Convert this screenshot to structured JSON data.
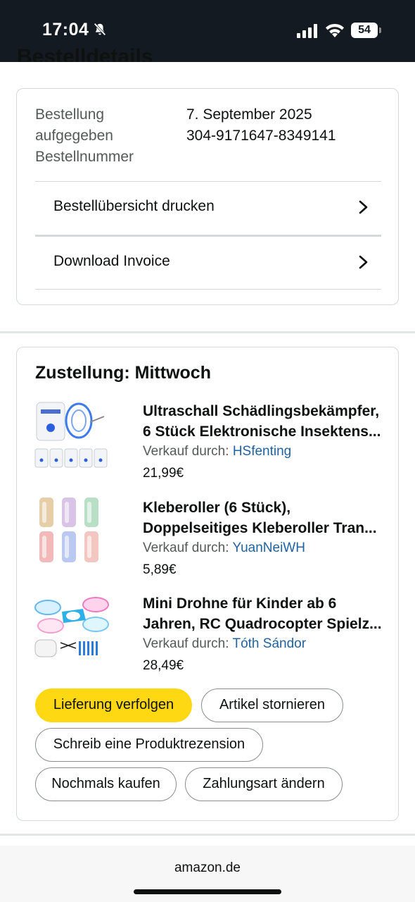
{
  "status_bar": {
    "time": "17:04",
    "battery": "54",
    "icons": [
      "bell-slash-icon",
      "cellular-signal-icon",
      "wifi-icon",
      "battery-icon"
    ]
  },
  "page": {
    "heading_partial": "Bestelldetails"
  },
  "order_info": {
    "labels": [
      "Bestellung",
      "aufgegeben",
      "Bestellnummer"
    ],
    "date": "7. September 2025",
    "order_number": "304-9171647-8349141",
    "links": [
      {
        "label": "Bestellübersicht drucken"
      },
      {
        "label": "Download Invoice"
      }
    ]
  },
  "delivery": {
    "title": "Zustellung: Mittwoch",
    "seller_prefix": "Verkauf durch:",
    "items": [
      {
        "title_line1": "Ultraschall Schädlingsbekämpfer,",
        "title_line2": "6 Stück Elektronische Insektens...",
        "seller": "HSfenting",
        "price": "21,99€",
        "image": "ultrasonic-pest-repeller-image"
      },
      {
        "title_line1": "Kleberoller (6 Stück),",
        "title_line2": "Doppelseitiges Kleberoller Tran...",
        "seller": "YuanNeiWH",
        "price": "5,89€",
        "image": "lint-roller-image"
      },
      {
        "title_line1": "Mini Drohne für Kinder ab 6",
        "title_line2": "Jahren, RC Quadrocopter Spielz...",
        "seller": "Tóth Sándor",
        "price": "28,49€",
        "image": "mini-drone-image"
      }
    ],
    "actions": {
      "track": "Lieferung verfolgen",
      "cancel": "Artikel stornieren",
      "review": "Schreib eine Produktrezension",
      "buy_again": "Nochmals kaufen",
      "change_payment": "Zahlungsart ändern"
    }
  },
  "browser": {
    "url": "amazon.de"
  },
  "colors": {
    "status_bar_bg": "#131a22",
    "primary_button": "#ffd814",
    "link": "#2162a1",
    "border": "#d5d9d9"
  }
}
